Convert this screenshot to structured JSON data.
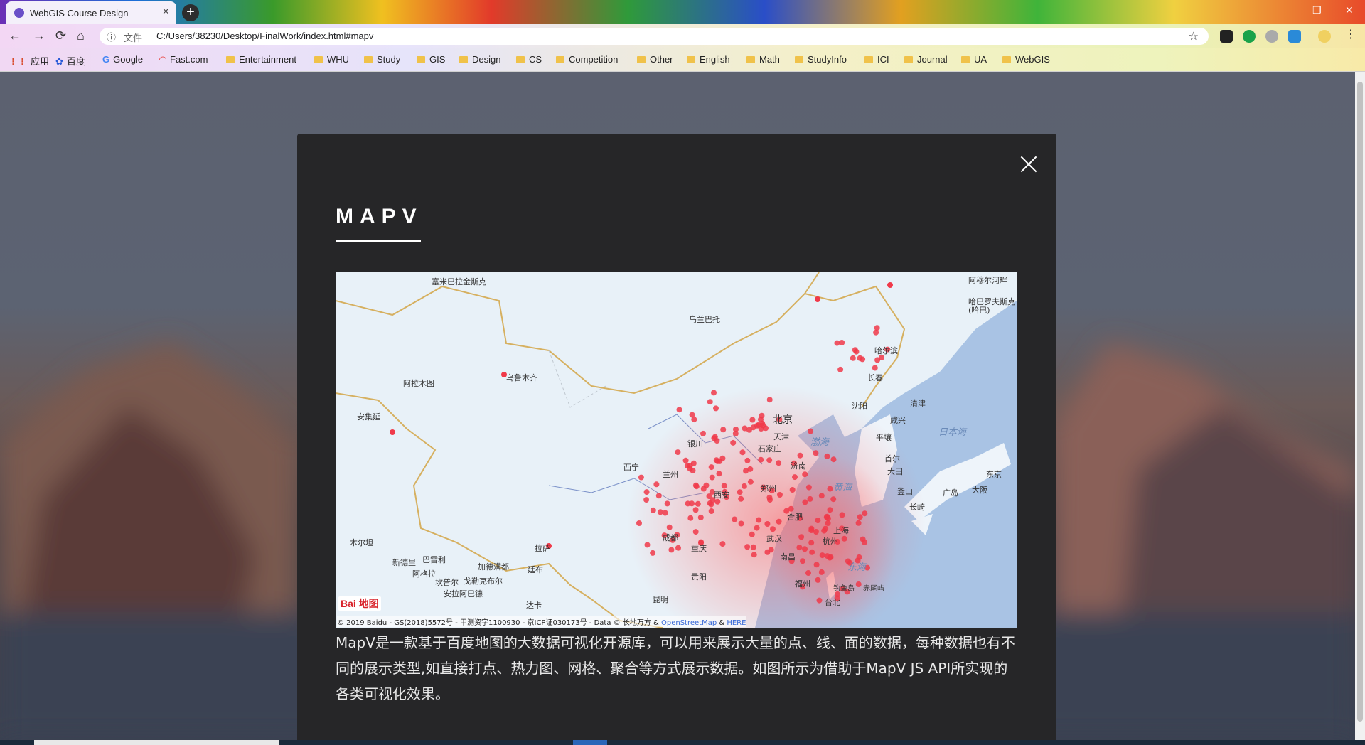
{
  "browser": {
    "tab_title": "WebGIS Course Design",
    "tab_close": "×",
    "new_tab": "+",
    "window_controls": [
      "—",
      "❐",
      "✕"
    ],
    "nav": {
      "back": "←",
      "forward": "→",
      "reload": "⟳",
      "home": "⌂"
    },
    "omnibox": {
      "info_icon": "ⓘ",
      "scheme_label": "文件",
      "url": "C:/Users/38230/Desktop/FinalWork/index.html#mapv",
      "star": "☆"
    },
    "bookmarks": [
      {
        "label": "应用",
        "icon": "apps-grid-icon"
      },
      {
        "label": "百度",
        "icon": "baidu-paw-icon"
      },
      {
        "label": "Google",
        "icon": "google-g-icon"
      },
      {
        "label": "Fast.com",
        "icon": "fast-speed-icon"
      },
      {
        "label": "Entertainment",
        "icon": "folder-icon"
      },
      {
        "label": "WHU",
        "icon": "folder-icon"
      },
      {
        "label": "Study",
        "icon": "folder-icon"
      },
      {
        "label": "GIS",
        "icon": "folder-icon"
      },
      {
        "label": "Design",
        "icon": "folder-icon"
      },
      {
        "label": "CS",
        "icon": "folder-icon"
      },
      {
        "label": "Competition",
        "icon": "folder-icon"
      },
      {
        "label": "Other",
        "icon": "folder-icon"
      },
      {
        "label": "English",
        "icon": "folder-icon"
      },
      {
        "label": "Math",
        "icon": "folder-icon"
      },
      {
        "label": "StudyInfo",
        "icon": "folder-icon"
      },
      {
        "label": "ICI",
        "icon": "folder-icon"
      },
      {
        "label": "Journal",
        "icon": "folder-icon"
      },
      {
        "label": "UA",
        "icon": "folder-icon"
      },
      {
        "label": "WebGIS",
        "icon": "folder-icon"
      }
    ]
  },
  "modal": {
    "title": "MAPV",
    "close_icon": "close-icon",
    "description": "MapV是一款基于百度地图的大数据可视化开源库，可以用来展示大量的点、线、面的数据，每种数据也有不同的展示类型,如直接打点、热力图、网格、聚合等方式展示数据。如图所示为借助于MapV JS API所实现的各类可视化效果。",
    "map": {
      "cities": [
        {
          "name": "塞米巴拉金斯克"
        },
        {
          "name": "乌兰巴托"
        },
        {
          "name": "乌鲁木齐"
        },
        {
          "name": "阿拉木图"
        },
        {
          "name": "安集延"
        },
        {
          "name": "哈尔滨"
        },
        {
          "name": "长春"
        },
        {
          "name": "沈阳"
        },
        {
          "name": "北京"
        },
        {
          "name": "天津"
        },
        {
          "name": "石家庄"
        },
        {
          "name": "济南"
        },
        {
          "name": "银川"
        },
        {
          "name": "西宁"
        },
        {
          "name": "兰州"
        },
        {
          "name": "西安"
        },
        {
          "name": "郑州"
        },
        {
          "name": "合肥"
        },
        {
          "name": "武汉"
        },
        {
          "name": "上海"
        },
        {
          "name": "杭州"
        },
        {
          "name": "南昌"
        },
        {
          "name": "成都"
        },
        {
          "name": "重庆"
        },
        {
          "name": "贵阳"
        },
        {
          "name": "昆明"
        },
        {
          "name": "拉萨"
        },
        {
          "name": "福州"
        },
        {
          "name": "台北"
        },
        {
          "name": "平壤"
        },
        {
          "name": "首尔"
        },
        {
          "name": "大田"
        },
        {
          "name": "釜山"
        },
        {
          "name": "广岛"
        },
        {
          "name": "大阪"
        },
        {
          "name": "东京"
        },
        {
          "name": "长崎"
        },
        {
          "name": "清津"
        },
        {
          "name": "咸兴"
        },
        {
          "name": "哈巴罗夫斯克(哈巴)"
        },
        {
          "name": "阿穆尔河畔"
        },
        {
          "name": "木尔坦"
        },
        {
          "name": "新德里"
        },
        {
          "name": "巴雷利"
        },
        {
          "name": "阿格拉"
        },
        {
          "name": "加德满都"
        },
        {
          "name": "廷布"
        },
        {
          "name": "坎普尔"
        },
        {
          "name": "戈勒克布尔"
        },
        {
          "name": "安拉阿巴德"
        },
        {
          "name": "达卡"
        },
        {
          "name": "钓鱼岛"
        },
        {
          "name": "赤尾屿"
        }
      ],
      "seas": [
        "渤海",
        "黄海",
        "东海",
        "日本海"
      ],
      "logo": "Bai 地图",
      "copyright": "© 2019 Baidu - GS(2018)5572号 - 甲测资字1100930 - 京ICP证030173号 - Data © 长地万方 & ",
      "copyright_links": [
        "OpenStreetMap",
        "HERE"
      ],
      "copyright_amp": " & "
    }
  }
}
